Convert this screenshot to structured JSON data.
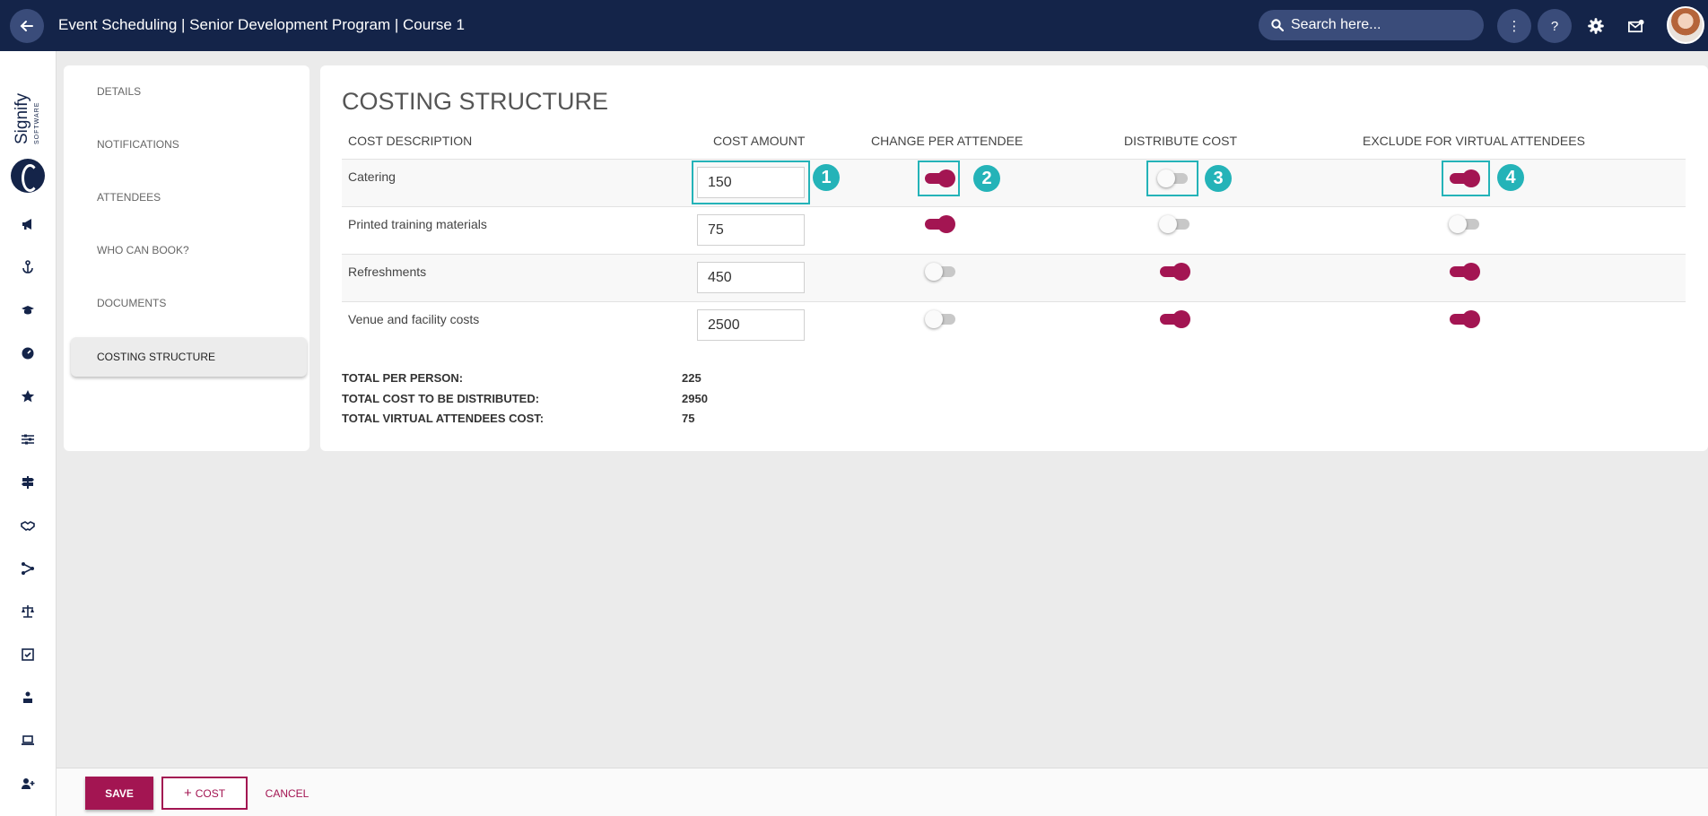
{
  "header": {
    "title": "Event Scheduling | Senior Development Program | Course 1",
    "search_placeholder": "Search here...",
    "help_label": "?",
    "more_label": "⋮"
  },
  "logo": {
    "name": "Signify",
    "sub": "SOFTWARE"
  },
  "rail_icons": [
    "megaphone-icon",
    "anchor-icon",
    "graduation-cap-icon",
    "dashboard-icon",
    "star-icon",
    "sliders-icon",
    "signpost-icon",
    "handshake-icon",
    "network-icon",
    "scales-icon",
    "checklist-icon",
    "user-board-icon",
    "laptop-icon",
    "add-user-icon"
  ],
  "sidenav": {
    "items": [
      {
        "label": "DETAILS"
      },
      {
        "label": "NOTIFICATIONS"
      },
      {
        "label": "ATTENDEES"
      },
      {
        "label": "WHO CAN BOOK?"
      },
      {
        "label": "DOCUMENTS"
      },
      {
        "label": "COSTING STRUCTURE",
        "active": true
      }
    ]
  },
  "costing": {
    "title": "COSTING STRUCTURE",
    "columns": [
      "COST DESCRIPTION",
      "COST AMOUNT",
      "CHANGE PER ATTENDEE",
      "DISTRIBUTE COST",
      "EXCLUDE FOR VIRTUAL ATTENDEES"
    ],
    "rows": [
      {
        "description": "Catering",
        "amount": "150",
        "change_per_attendee": true,
        "distribute_cost": false,
        "exclude_virtual": true
      },
      {
        "description": "Printed training materials",
        "amount": "75",
        "change_per_attendee": true,
        "distribute_cost": false,
        "exclude_virtual": false
      },
      {
        "description": "Refreshments",
        "amount": "450",
        "change_per_attendee": false,
        "distribute_cost": true,
        "exclude_virtual": true
      },
      {
        "description": "Venue and facility costs",
        "amount": "2500",
        "change_per_attendee": false,
        "distribute_cost": true,
        "exclude_virtual": true
      }
    ],
    "callouts": [
      "1",
      "2",
      "3",
      "4"
    ],
    "totals": [
      {
        "label": "TOTAL PER PERSON:",
        "value": "225"
      },
      {
        "label": "TOTAL COST TO BE DISTRIBUTED:",
        "value": "2950"
      },
      {
        "label": "TOTAL VIRTUAL ATTENDEES COST:",
        "value": "75"
      }
    ]
  },
  "footer": {
    "save_label": "SAVE",
    "cost_label": "COST",
    "cancel_label": "CANCEL"
  },
  "colors": {
    "header_bg": "#142449",
    "accent": "#a31552",
    "callout": "#24b3b8"
  }
}
